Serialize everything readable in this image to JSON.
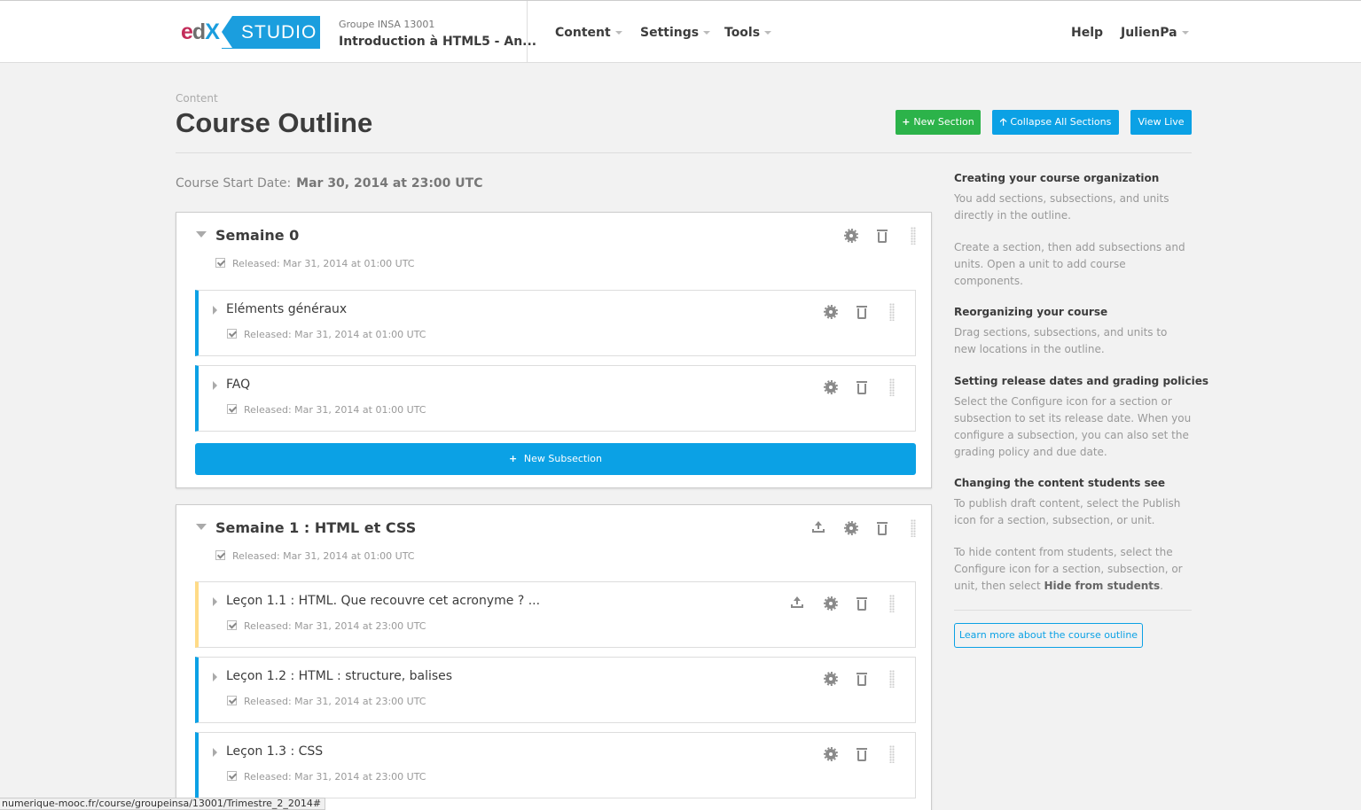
{
  "header": {
    "logo_edx": "edX",
    "logo_studio": "STUDIO",
    "course_org": "Groupe INSA 13001",
    "course_title": "Introduction à HTML5 - An...",
    "nav": [
      {
        "label": "Content"
      },
      {
        "label": "Settings"
      },
      {
        "label": "Tools"
      }
    ],
    "help": "Help",
    "user": "JulienPa"
  },
  "page": {
    "breadcrumb": "Content",
    "title": "Course Outline",
    "new_section": "New Section",
    "collapse_all": "Collapse All Sections",
    "view_live": "View Live",
    "start_date_label": "Course Start Date:",
    "start_date_value": "Mar 30, 2014 at 23:00 UTC"
  },
  "sections": [
    {
      "title": "Semaine 0",
      "status": "Released: Mar 31, 2014 at 01:00 UTC",
      "subsections": [
        {
          "title": "Eléments généraux",
          "status": "Released: Mar 31, 2014 at 01:00 UTC"
        },
        {
          "title": "FAQ",
          "status": "Released: Mar 31, 2014 at 01:00 UTC"
        }
      ],
      "new_subsection": "New Subsection"
    },
    {
      "title": "Semaine 1 : HTML et CSS",
      "status": "Released: Mar 31, 2014 at 01:00 UTC",
      "subsections": [
        {
          "title": "Leçon 1.1 : HTML. Que recouvre cet acronyme ? ...",
          "status": "Released: Mar 31, 2014 at 23:00 UTC",
          "draft": true
        },
        {
          "title": "Leçon 1.2 : HTML : structure, balises",
          "status": "Released: Mar 31, 2014 at 23:00 UTC"
        },
        {
          "title": "Leçon 1.3 : CSS",
          "status": "Released: Mar 31, 2014 at 23:00 UTC"
        }
      ]
    }
  ],
  "sidebar": {
    "blocks": [
      {
        "heading": "Creating your course organization",
        "paras": [
          "You add sections, subsections, and units directly in the outline.",
          "Create a section, then add subsections and units. Open a unit to add course components."
        ]
      },
      {
        "heading": "Reorganizing your course",
        "paras": [
          "Drag sections, subsections, and units to new locations in the outline."
        ]
      },
      {
        "heading": "Setting release dates and grading policies",
        "paras": [
          "Select the Configure icon for a section or subsection to set its release date. When you configure a subsection, you can also set the grading policy and due date."
        ]
      },
      {
        "heading": "Changing the content students see",
        "paras": [
          "To publish draft content, select the Publish icon for a section, subsection, or unit."
        ]
      }
    ],
    "hide_text_pre": "To hide content from students, select the Configure icon for a section, subsection, or unit, then select ",
    "hide_text_bold": "Hide from students",
    "hide_text_post": ".",
    "learn_more": "Learn more about the course outline"
  },
  "statusbar": {
    "url": "numerique-mooc.fr/course/groupeinsa/13001/Trimestre_2_2014#"
  },
  "colors": {
    "accent_blue": "#0ba1e5",
    "accent_green": "#2cb34a",
    "draft_yellow": "#ffdb87"
  }
}
